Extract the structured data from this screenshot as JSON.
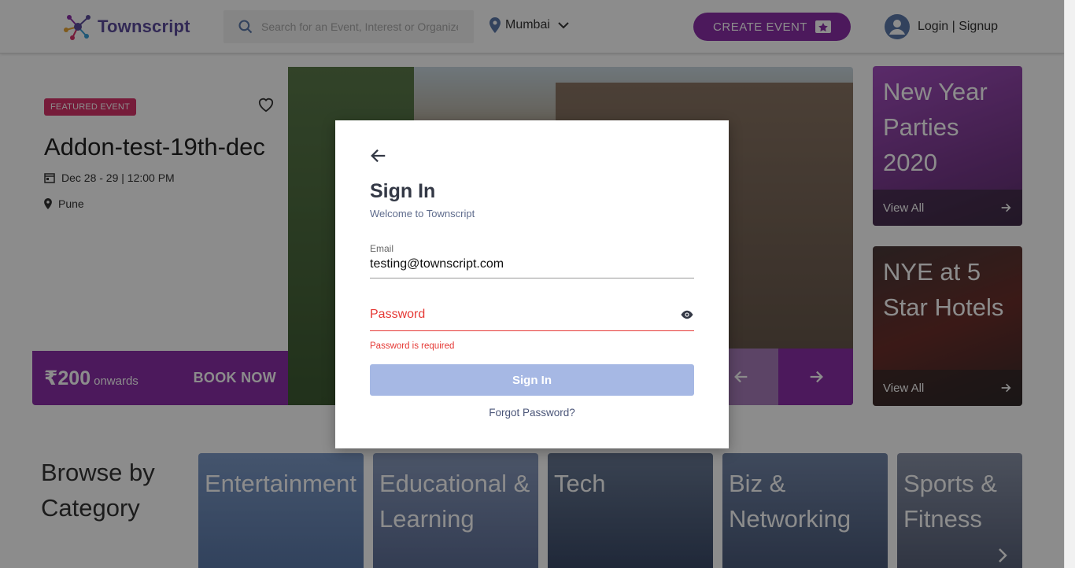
{
  "header": {
    "brand": "Townscript",
    "search_placeholder": "Search for an Event, Interest or Organizer",
    "city": "Mumbai",
    "create_event": "CREATE EVENT",
    "login": "Login | Signup"
  },
  "featured": {
    "badge": "FEATURED EVENT",
    "title": "Addon-test-19th-dec",
    "date": "Dec 28 - 29 | 12:00 PM",
    "location": "Pune",
    "price": "₹200",
    "price_suffix": "onwards",
    "book_now": "BOOK NOW"
  },
  "promos": [
    {
      "title": "New Year Parties 2020",
      "cta": "View All"
    },
    {
      "title": "NYE at 5 Star Hotels",
      "cta": "View All"
    }
  ],
  "browse": {
    "title": "Browse by Category",
    "categories": [
      "Entertainment",
      "Educational & Learning",
      "Tech",
      "Biz & Networking",
      "Sports & Fitness"
    ]
  },
  "modal": {
    "title": "Sign In",
    "subtitle": "Welcome to Townscript",
    "email_label": "Email",
    "email_value": "testing@townscript.com",
    "password_placeholder": "Password",
    "password_error": "Password is required",
    "submit": "Sign In",
    "forgot": "Forgot Password?"
  },
  "colors": {
    "brand_purple": "#8b2fa8",
    "error": "#e53935",
    "button_disabled": "#a6b8e4"
  }
}
